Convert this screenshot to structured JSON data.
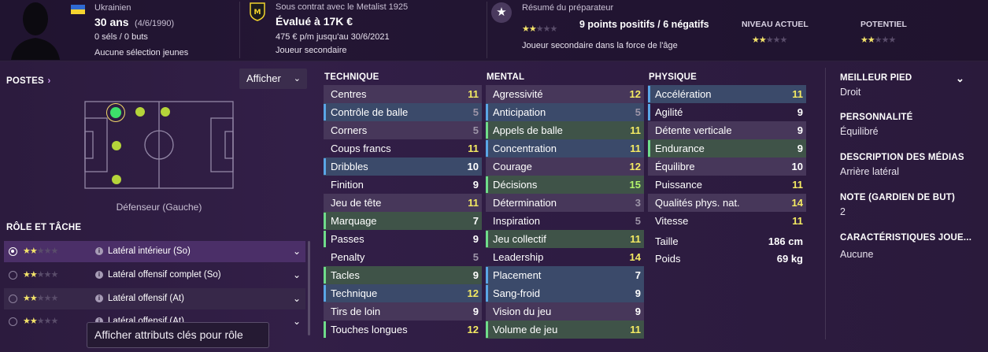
{
  "header": {
    "nationality": "Ukrainien",
    "age": "30 ans",
    "birth": "(4/6/1990)",
    "caps": "0 séls / 0 buts",
    "youth": "Aucune sélection jeunes",
    "contract_line": "Sous contrat avec le Metalist 1925",
    "value": "Évalué à 17K €",
    "wage": "475 € p/m jusqu'au 30/6/2021",
    "squad_status": "Joueur secondaire",
    "scout_title": "Résumé du préparateur",
    "scout_summary": "9 points positifs / 6 négatifs",
    "scout_note": "Joueur secondaire dans la force de l'âge",
    "current_label": "NIVEAU ACTUEL",
    "potential_label": "POTENTIEL",
    "scout_stars": 2,
    "current_stars": 2,
    "potential_stars": 2
  },
  "positions": {
    "title": "POSTES",
    "button": "Afficher",
    "label": "Défenseur (Gauche)"
  },
  "roles": {
    "title": "RÔLE ET TÂCHE",
    "items": [
      {
        "label": "Latéral intérieur (So)",
        "stars": 2
      },
      {
        "label": "Latéral offensif complet (So)",
        "stars": 2
      },
      {
        "label": "Latéral offensif (At)",
        "stars": 2
      },
      {
        "label": "Latéral offensif (At)",
        "stars": 2
      }
    ],
    "tooltip": "Afficher attributs clés pour rôle"
  },
  "technique": {
    "title": "TECHNIQUE",
    "rows": [
      {
        "name": "Centres",
        "value": "11"
      },
      {
        "name": "Contrôle de balle",
        "value": "5"
      },
      {
        "name": "Corners",
        "value": "5"
      },
      {
        "name": "Coups francs",
        "value": "11"
      },
      {
        "name": "Dribbles",
        "value": "10"
      },
      {
        "name": "Finition",
        "value": "9"
      },
      {
        "name": "Jeu de tête",
        "value": "11"
      },
      {
        "name": "Marquage",
        "value": "7"
      },
      {
        "name": "Passes",
        "value": "9"
      },
      {
        "name": "Penalty",
        "value": "5"
      },
      {
        "name": "Tacles",
        "value": "9"
      },
      {
        "name": "Technique",
        "value": "12"
      },
      {
        "name": "Tirs de loin",
        "value": "9"
      },
      {
        "name": "Touches longues",
        "value": "12"
      }
    ]
  },
  "mental": {
    "title": "MENTAL",
    "rows": [
      {
        "name": "Agressivité",
        "value": "12"
      },
      {
        "name": "Anticipation",
        "value": "5"
      },
      {
        "name": "Appels de balle",
        "value": "11"
      },
      {
        "name": "Concentration",
        "value": "11"
      },
      {
        "name": "Courage",
        "value": "12"
      },
      {
        "name": "Décisions",
        "value": "15"
      },
      {
        "name": "Détermination",
        "value": "3"
      },
      {
        "name": "Inspiration",
        "value": "5"
      },
      {
        "name": "Jeu collectif",
        "value": "11"
      },
      {
        "name": "Leadership",
        "value": "14"
      },
      {
        "name": "Placement",
        "value": "7"
      },
      {
        "name": "Sang-froid",
        "value": "9"
      },
      {
        "name": "Vision du jeu",
        "value": "9"
      },
      {
        "name": "Volume de jeu",
        "value": "11"
      }
    ]
  },
  "physique": {
    "title": "PHYSIQUE",
    "rows": [
      {
        "name": "Accélération",
        "value": "11"
      },
      {
        "name": "Agilité",
        "value": "9"
      },
      {
        "name": "Détente verticale",
        "value": "9"
      },
      {
        "name": "Endurance",
        "value": "9"
      },
      {
        "name": "Équilibre",
        "value": "10"
      },
      {
        "name": "Puissance",
        "value": "11"
      },
      {
        "name": "Qualités phys. nat.",
        "value": "14"
      },
      {
        "name": "Vitesse",
        "value": "11"
      }
    ],
    "height_label": "Taille",
    "height": "186 cm",
    "weight_label": "Poids",
    "weight": "69 kg"
  },
  "details": {
    "foot_label": "MEILLEUR PIED",
    "foot": "Droit",
    "personality_label": "PERSONNALITÉ",
    "personality": "Équilibré",
    "media_label": "DESCRIPTION DES MÉDIAS",
    "media": "Arrière latéral",
    "gk_label": "NOTE (GARDIEN DE BUT)",
    "gk": "2",
    "traits_label": "CARACTÉRISTIQUES JOUE...",
    "traits": "Aucune"
  },
  "colors": {
    "accent_star": "#f3e36a",
    "position_natural": "#3de06a",
    "position_other": "#b5d43a"
  }
}
